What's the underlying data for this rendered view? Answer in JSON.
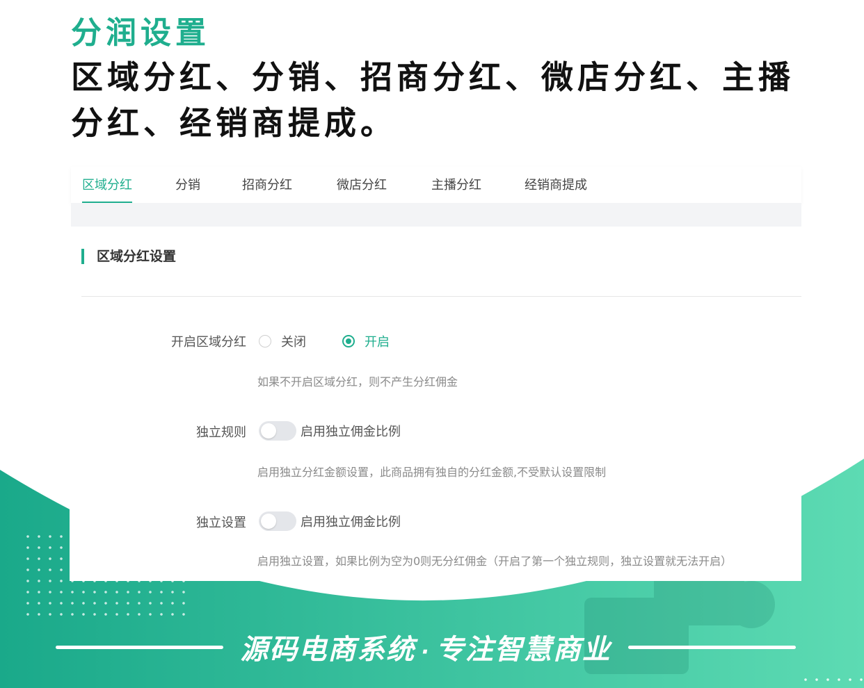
{
  "headline": {
    "subtitle": "分润设置",
    "line1": "区域分红、分销、招商分红、微店分红、主播",
    "line2": "分红、经销商提成。"
  },
  "tabs": [
    {
      "label": "区域分红",
      "active": true
    },
    {
      "label": "分销",
      "active": false
    },
    {
      "label": "招商分红",
      "active": false
    },
    {
      "label": "微店分红",
      "active": false
    },
    {
      "label": "主播分红",
      "active": false
    },
    {
      "label": "经销商提成",
      "active": false
    }
  ],
  "section_title": "区域分红设置",
  "form": {
    "region_label": "开启区域分红",
    "radio_off": "关闭",
    "radio_on": "开启",
    "selected": "开启",
    "region_hint": "如果不开启区域分红，则不产生分红佣金",
    "rule_label": "独立规则",
    "rule_switch_text": "启用独立佣金比例",
    "rule_switch_on": false,
    "rule_hint": "启用独立分红金额设置，此商品拥有独自的分红金额,不受默认设置限制",
    "setting_label": "独立设置",
    "setting_switch_text": "启用独立佣金比例",
    "setting_switch_on": false,
    "setting_hint": "启用独立设置，如果比例为空为0则无分红佣金（开启了第一个独立规则，独立设置就无法开启）"
  },
  "slogan": {
    "left": "源码电商系统",
    "sep": "·",
    "right": "专注智慧商业"
  },
  "colors": {
    "accent": "#1fae8e",
    "band_start": "#1aa98a",
    "band_end": "#5ddbb3"
  }
}
